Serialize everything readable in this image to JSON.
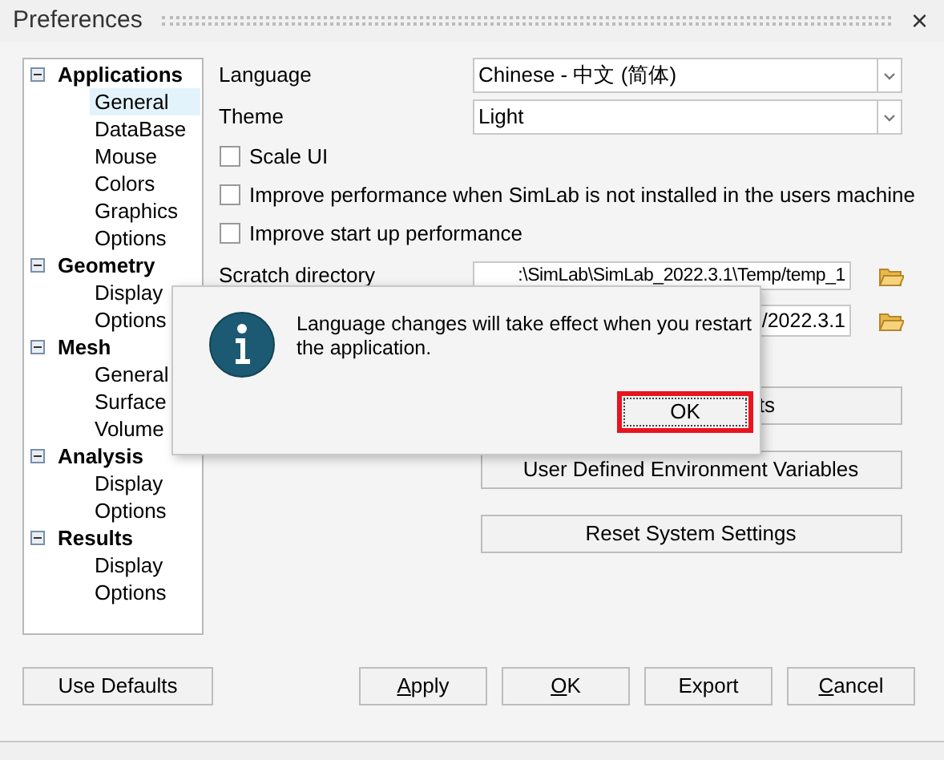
{
  "window": {
    "title": "Preferences",
    "close": "×"
  },
  "tree": [
    {
      "label": "Applications",
      "expanded": true,
      "children": [
        {
          "label": "General",
          "selected": true
        },
        {
          "label": "DataBase",
          "selected": false
        },
        {
          "label": "Mouse",
          "selected": false
        },
        {
          "label": "Colors",
          "selected": false
        },
        {
          "label": "Graphics",
          "selected": false
        },
        {
          "label": "Options",
          "selected": false
        }
      ]
    },
    {
      "label": "Geometry",
      "expanded": true,
      "children": [
        {
          "label": "Display",
          "selected": false
        },
        {
          "label": "Options",
          "selected": false
        }
      ]
    },
    {
      "label": "Mesh",
      "expanded": true,
      "children": [
        {
          "label": "General",
          "selected": false
        },
        {
          "label": "Surface",
          "selected": false
        },
        {
          "label": "Volume",
          "selected": false
        }
      ]
    },
    {
      "label": "Analysis",
      "expanded": true,
      "children": [
        {
          "label": "Display",
          "selected": false
        },
        {
          "label": "Options",
          "selected": false
        }
      ]
    },
    {
      "label": "Results",
      "expanded": true,
      "children": [
        {
          "label": "Display",
          "selected": false
        },
        {
          "label": "Options",
          "selected": false
        }
      ]
    }
  ],
  "settings": {
    "language": {
      "label": "Language",
      "value": "Chinese - 中文 (简体)"
    },
    "theme": {
      "label": "Theme",
      "value": "Light"
    },
    "checkboxes": [
      {
        "label": "Scale UI",
        "checked": false
      },
      {
        "label": "Improve performance when SimLab is not installed in the users machine",
        "checked": false
      },
      {
        "label": "Improve start up performance",
        "checked": false
      }
    ],
    "directories": [
      {
        "label": "Scratch directory",
        "value": ":\\SimLab\\SimLab_2022.3.1\\Temp/temp_1"
      },
      {
        "value": "/2022.3.1"
      }
    ],
    "buttons": [
      "ts",
      "User Defined Environment Variables",
      "Reset System Settings"
    ]
  },
  "footer": {
    "use_defaults": "Use Defaults",
    "buttons": [
      {
        "label": "Apply",
        "underlined": true
      },
      {
        "label": "OK",
        "underlined": true
      },
      {
        "label": "Export",
        "underlined": false
      },
      {
        "label": "Cancel",
        "underlined": true
      }
    ]
  },
  "message_box": {
    "message": "Language changes will take effect when you restart the application.",
    "ok": "OK",
    "focused": true
  }
}
